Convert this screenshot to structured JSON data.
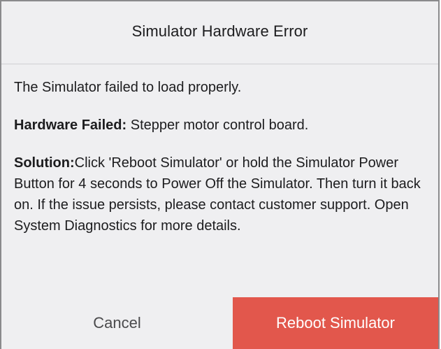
{
  "dialog": {
    "title": "Simulator Hardware Error",
    "message": "The Simulator failed to load properly.",
    "hardware_label": "Hardware Failed:",
    "hardware_value": " Stepper motor control board.",
    "solution_label": "Solution:",
    "solution_text": "Click 'Reboot Simulator' or hold the Simulator Power Button for 4 seconds to Power Off the Simulator. Then turn it back on. If the issue persists, please contact customer support. Open System Diagnostics for more details.",
    "cancel_label": "Cancel",
    "reboot_label": "Reboot Simulator"
  },
  "colors": {
    "dialog_background": "#efeff1",
    "primary_button": "#e2574c",
    "primary_button_text": "#ffffff",
    "cancel_text": "#4a4a4c",
    "body_text": "#1c1c1e"
  }
}
